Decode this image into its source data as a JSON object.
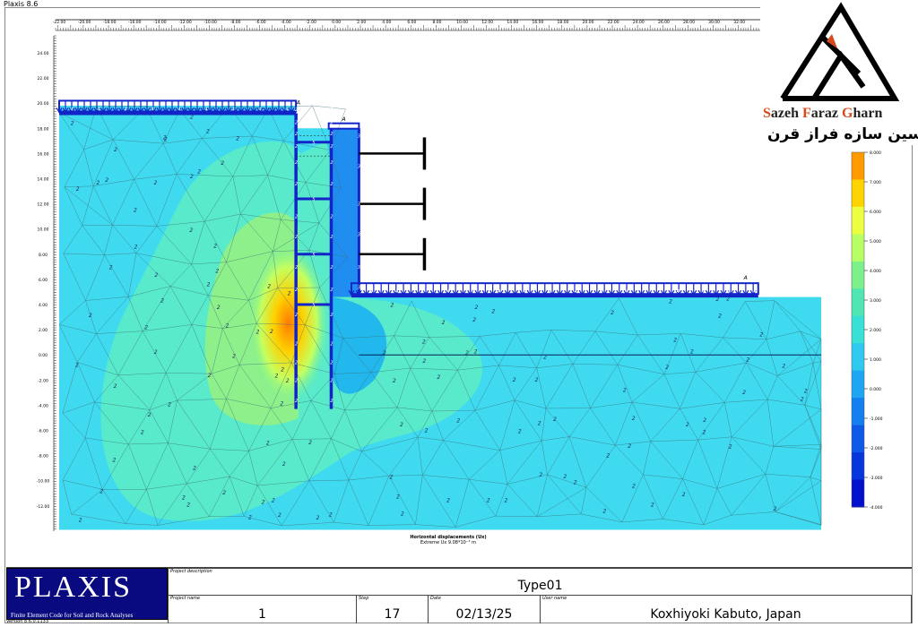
{
  "app": {
    "title": "Plaxis 8.6"
  },
  "logo": {
    "name_parts": [
      {
        "cap": "S",
        "rest": "azeh "
      },
      {
        "cap": "F",
        "rest": "araz "
      },
      {
        "cap": "G",
        "rest": "harn"
      }
    ],
    "name": "Sazeh Faraz Gharn",
    "name_fa": "مهندسین سازه فراز قرن",
    "brand_color": "#d84a1b"
  },
  "plot": {
    "x_ticks": [
      "-22.00",
      "-20.00",
      "-18.00",
      "-16.00",
      "-14.00",
      "-12.00",
      "-10.00",
      "-8.00",
      "-6.00",
      "-4.00",
      "-2.00",
      "0.00",
      "2.00",
      "4.00",
      "6.00",
      "8.00",
      "10.00",
      "12.00",
      "14.00",
      "16.00",
      "18.00",
      "20.00",
      "22.00",
      "24.00",
      "26.00",
      "28.00",
      "30.00",
      "32.00",
      "3"
    ],
    "y_ticks": [
      "24.00",
      "22.00",
      "20.00",
      "18.00",
      "16.00",
      "14.00",
      "12.00",
      "10.00",
      "8.00",
      "6.00",
      "4.00",
      "2.00",
      "0.00",
      "-2.00",
      "-4.00",
      "-6.00",
      "-8.00",
      "-10.00",
      "-12.00"
    ],
    "legend_ticks": [
      "8.000",
      "7.000",
      "6.000",
      "5.000",
      "4.000",
      "3.000",
      "2.000",
      "1.000",
      "0.000",
      "-1.000",
      "-2.000",
      "-3.000",
      "-4.000"
    ],
    "legend_colors": [
      "#ff9a00",
      "#ffd400",
      "#ecff40",
      "#b8ff66",
      "#7cf08a",
      "#4fe6b4",
      "#38e0d6",
      "#2fc8ee",
      "#1ea6f2",
      "#1480ee",
      "#0c5ae6",
      "#0636dc",
      "#0010cc"
    ],
    "load_labels": [
      "A",
      "A",
      "A"
    ],
    "anchor_label": "5",
    "mesh_label": "2",
    "load_label": "4",
    "wall_label": "3"
  },
  "caption": {
    "title": "Horizontal displacements (Ux)",
    "extreme": "Extreme Ux 9.08*10⁻³ m"
  },
  "footer": {
    "brand": "PLAXIS",
    "subtitle": "Finite Element Code for Soil and Rock Analyses",
    "version": "Version 8.6.0.1133",
    "project_description_label": "Project description",
    "project_description": "Type01",
    "project_name_label": "Project name",
    "project_name": "1",
    "step_label": "Step",
    "step": "17",
    "date_label": "Date",
    "date": "02/13/25",
    "user_name_label": "User name",
    "user_name": "Koxhiyoki Kabuto, Japan"
  }
}
